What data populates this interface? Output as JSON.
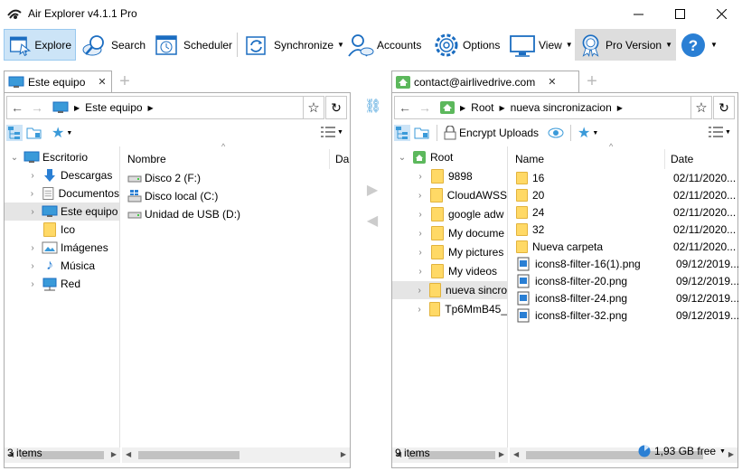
{
  "window": {
    "title": "Air Explorer v4.1.1 Pro",
    "controls": [
      "minimize",
      "maximize",
      "close"
    ]
  },
  "toolbar": {
    "items": [
      {
        "label": "Explore",
        "icon": "explore-icon",
        "active": true
      },
      {
        "label": "Search",
        "icon": "search-icon"
      },
      {
        "label": "Scheduler",
        "icon": "calendar-icon"
      },
      {
        "label": "Synchronize",
        "icon": "sync-icon",
        "dropdown": true
      },
      {
        "label": "Accounts",
        "icon": "accounts-icon"
      },
      {
        "label": "Options",
        "icon": "gear-icon"
      },
      {
        "label": "View",
        "icon": "monitor-icon",
        "dropdown": true
      },
      {
        "label": "Pro Version",
        "icon": "medal-icon",
        "dropdown": true
      },
      {
        "label": "",
        "icon": "help-icon",
        "dropdown": true
      }
    ]
  },
  "left_pane": {
    "tab_label": "Este equipo",
    "breadcrumb": [
      "Este equipo"
    ],
    "tree": [
      {
        "label": "Escritorio",
        "icon": "desktop-icon",
        "level": 0,
        "expanded": true
      },
      {
        "label": "Descargas",
        "icon": "download-icon",
        "level": 1
      },
      {
        "label": "Documentos",
        "icon": "document-icon",
        "level": 1
      },
      {
        "label": "Este equipo",
        "icon": "computer-icon",
        "level": 1,
        "selected": true
      },
      {
        "label": "Ico",
        "icon": "folder-icon",
        "level": 1
      },
      {
        "label": "Imágenes",
        "icon": "pictures-icon",
        "level": 1
      },
      {
        "label": "Música",
        "icon": "music-icon",
        "level": 1
      },
      {
        "label": "Red",
        "icon": "network-icon",
        "level": 1
      }
    ],
    "columns": [
      "Nombre",
      "Da"
    ],
    "files": [
      {
        "name": "Disco 2 (F:)",
        "icon": "drive-icon"
      },
      {
        "name": "Disco local (C:)",
        "icon": "drive-windows-icon"
      },
      {
        "name": "Unidad de USB (D:)",
        "icon": "drive-icon"
      }
    ],
    "status": "3 items"
  },
  "right_pane": {
    "tab_label": "contact@airlivedrive.com",
    "breadcrumb": [
      "Root",
      "nueva sincronizacion"
    ],
    "encrypt_label": "Encrypt Uploads",
    "tree": [
      {
        "label": "Root",
        "icon": "cloud-root-icon",
        "level": 0,
        "expanded": true
      },
      {
        "label": "9898",
        "icon": "folder-icon",
        "level": 1
      },
      {
        "label": "CloudAWSS",
        "icon": "folder-icon",
        "level": 1
      },
      {
        "label": "google adw",
        "icon": "folder-icon",
        "level": 1
      },
      {
        "label": "My docume",
        "icon": "folder-icon",
        "level": 1
      },
      {
        "label": "My pictures",
        "icon": "folder-icon",
        "level": 1
      },
      {
        "label": "My videos",
        "icon": "folder-icon",
        "level": 1
      },
      {
        "label": "nueva sincro",
        "icon": "folder-icon",
        "level": 1,
        "selected": true
      },
      {
        "label": "Tp6MmB45_",
        "icon": "folder-icon",
        "level": 1
      }
    ],
    "columns": [
      "Name",
      "Date"
    ],
    "files": [
      {
        "name": "16",
        "icon": "folder-icon",
        "date": "02/11/2020..."
      },
      {
        "name": "20",
        "icon": "folder-icon",
        "date": "02/11/2020..."
      },
      {
        "name": "24",
        "icon": "folder-icon",
        "date": "02/11/2020..."
      },
      {
        "name": "32",
        "icon": "folder-icon",
        "date": "02/11/2020..."
      },
      {
        "name": "Nueva carpeta",
        "icon": "folder-icon",
        "date": "02/11/2020..."
      },
      {
        "name": "icons8-filter-16(1).png",
        "icon": "image-file-icon",
        "date": "09/12/2019..."
      },
      {
        "name": "icons8-filter-20.png",
        "icon": "image-file-icon",
        "date": "09/12/2019..."
      },
      {
        "name": "icons8-filter-24.png",
        "icon": "image-file-icon",
        "date": "09/12/2019..."
      },
      {
        "name": "icons8-filter-32.png",
        "icon": "image-file-icon",
        "date": "09/12/2019..."
      }
    ],
    "status": "9 items",
    "free_space": "1,93 GB free"
  },
  "colors": {
    "accent": "#1b6dc1",
    "selection": "#e5e5e5",
    "active_tool": "#cce4f7",
    "folder": "#ffd966",
    "cloud_green": "#5cb85c"
  }
}
